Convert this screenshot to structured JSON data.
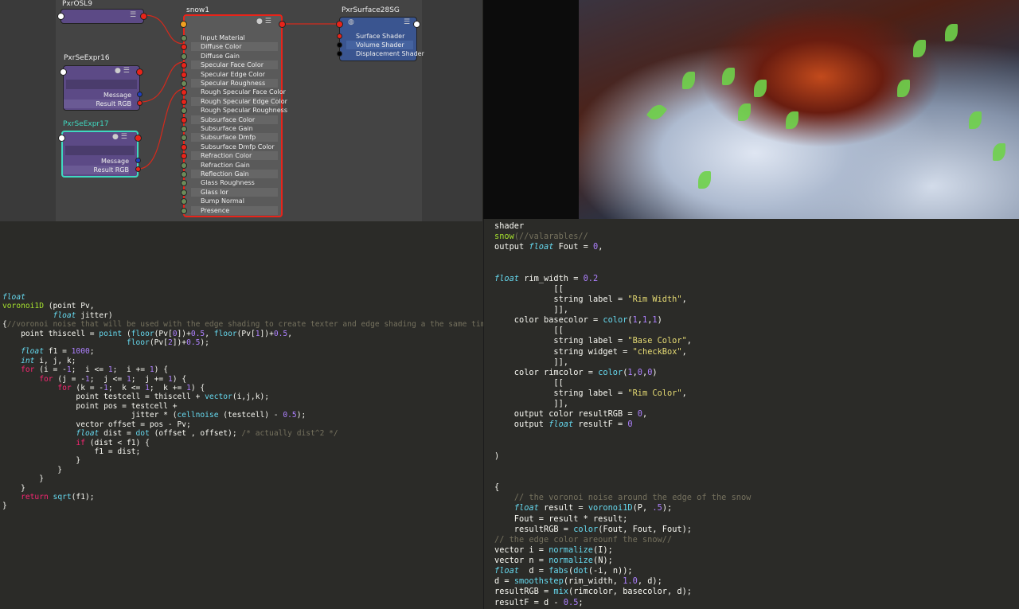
{
  "node_editor": {
    "nodes": {
      "osl": {
        "title": "PxrOSL9"
      },
      "seexpr16": {
        "title": "PxrSeExpr16",
        "ports": [
          "Message",
          "Result RGB"
        ]
      },
      "seexpr17": {
        "title": "PxrSeExpr17",
        "ports": [
          "Message",
          "Result RGB"
        ]
      },
      "snow": {
        "title": "snow1",
        "ports": [
          "Input Material",
          "Diffuse Color",
          "Diffuse Gain",
          "Specular Face Color",
          "Specular Edge Color",
          "Specular Roughness",
          "Rough Specular Face Color",
          "Rough Specular Edge Color",
          "Rough Specular Roughness",
          "Subsurface Color",
          "Subsurface Gain",
          "Subsurface Dmfp",
          "Subsurface Dmfp Color",
          "Refraction Color",
          "Refraction Gain",
          "Reflection Gain",
          "Glass Roughness",
          "Glass Ior",
          "Bump Normal",
          "Presence"
        ],
        "connected": [
          false,
          true,
          false,
          true,
          true,
          false,
          true,
          true,
          false,
          true,
          false,
          false,
          true,
          true,
          false,
          false,
          false,
          false,
          false,
          false
        ]
      },
      "surface": {
        "title": "PxrSurface28SG",
        "ports": [
          "Surface Shader",
          "Volume Shader",
          "Displacement Shader"
        ]
      }
    },
    "colors": {
      "accent_red": "#e8241a",
      "selected_teal": "#3fd9c0",
      "node_purple": "#5c4a86",
      "node_blue": "#3a5590"
    }
  },
  "code_left": [
    [
      [
        "type",
        "float"
      ]
    ],
    [
      [
        "def",
        "voronoi1D"
      ],
      [
        "plain",
        " (point Pv,"
      ]
    ],
    [
      [
        "plain",
        "           "
      ],
      [
        "type",
        "float"
      ],
      [
        "plain",
        " jitter)"
      ]
    ],
    [
      [
        "plain",
        "{"
      ],
      [
        "cm",
        "//voronoi noise that will be used with the edge shading to create texter and edge shading a the same time//"
      ]
    ],
    [
      [
        "plain",
        "    point thiscell = "
      ],
      [
        "fn",
        "point"
      ],
      [
        "plain",
        " ("
      ],
      [
        "fn",
        "floor"
      ],
      [
        "plain",
        "(Pv["
      ],
      [
        "num",
        "0"
      ],
      [
        "plain",
        "])+"
      ],
      [
        "num",
        "0.5"
      ],
      [
        "plain",
        ", "
      ],
      [
        "fn",
        "floor"
      ],
      [
        "plain",
        "(Pv["
      ],
      [
        "num",
        "1"
      ],
      [
        "plain",
        "])+"
      ],
      [
        "num",
        "0.5"
      ],
      [
        "plain",
        ","
      ]
    ],
    [
      [
        "plain",
        "                           "
      ],
      [
        "fn",
        "floor"
      ],
      [
        "plain",
        "(Pv["
      ],
      [
        "num",
        "2"
      ],
      [
        "plain",
        "])+"
      ],
      [
        "num",
        "0.5"
      ],
      [
        "plain",
        ");"
      ]
    ],
    [
      [
        "plain",
        "    "
      ],
      [
        "type",
        "float"
      ],
      [
        "plain",
        " f1 = "
      ],
      [
        "num",
        "1000"
      ],
      [
        "plain",
        ";"
      ]
    ],
    [
      [
        "plain",
        "    "
      ],
      [
        "type",
        "int"
      ],
      [
        "plain",
        " i, j, k;"
      ]
    ],
    [
      [
        "plain",
        "    "
      ],
      [
        "kw",
        "for"
      ],
      [
        "plain",
        " (i = -"
      ],
      [
        "num",
        "1"
      ],
      [
        "plain",
        ";  i <= "
      ],
      [
        "num",
        "1"
      ],
      [
        "plain",
        ";  i += "
      ],
      [
        "num",
        "1"
      ],
      [
        "plain",
        ") {"
      ]
    ],
    [
      [
        "plain",
        "        "
      ],
      [
        "kw",
        "for"
      ],
      [
        "plain",
        " (j = -"
      ],
      [
        "num",
        "1"
      ],
      [
        "plain",
        ";  j <= "
      ],
      [
        "num",
        "1"
      ],
      [
        "plain",
        ";  j += "
      ],
      [
        "num",
        "1"
      ],
      [
        "plain",
        ") {"
      ]
    ],
    [
      [
        "plain",
        "            "
      ],
      [
        "kw",
        "for"
      ],
      [
        "plain",
        " (k = -"
      ],
      [
        "num",
        "1"
      ],
      [
        "plain",
        ";  k <= "
      ],
      [
        "num",
        "1"
      ],
      [
        "plain",
        ";  k += "
      ],
      [
        "num",
        "1"
      ],
      [
        "plain",
        ") {"
      ]
    ],
    [
      [
        "plain",
        "                point testcell = thiscell + "
      ],
      [
        "fn",
        "vector"
      ],
      [
        "plain",
        "(i,j,k);"
      ]
    ],
    [
      [
        "plain",
        "                point pos = testcell +"
      ]
    ],
    [
      [
        "plain",
        "                            jitter * ("
      ],
      [
        "fn",
        "cellnoise"
      ],
      [
        "plain",
        " (testcell) - "
      ],
      [
        "num",
        "0.5"
      ],
      [
        "plain",
        ");"
      ]
    ],
    [
      [
        "plain",
        "                vector offset = pos - Pv;"
      ]
    ],
    [
      [
        "plain",
        "                "
      ],
      [
        "type",
        "float"
      ],
      [
        "plain",
        " dist = "
      ],
      [
        "fn",
        "dot"
      ],
      [
        "plain",
        " (offset , offset); "
      ],
      [
        "cm",
        "/* actually dist^2 */"
      ]
    ],
    [
      [
        "plain",
        "                "
      ],
      [
        "kw",
        "if"
      ],
      [
        "plain",
        " (dist < f1) {"
      ]
    ],
    [
      [
        "plain",
        "                    f1 = dist;"
      ]
    ],
    [
      [
        "plain",
        "                }"
      ]
    ],
    [
      [
        "plain",
        "            }"
      ]
    ],
    [
      [
        "plain",
        "        }"
      ]
    ],
    [
      [
        "plain",
        "    }"
      ]
    ],
    [
      [
        "plain",
        "    "
      ],
      [
        "kw",
        "return"
      ],
      [
        "plain",
        " "
      ],
      [
        "fn",
        "sqrt"
      ],
      [
        "plain",
        "(f1);"
      ]
    ],
    [
      [
        "plain",
        "}"
      ]
    ]
  ],
  "code_right": [
    [
      [
        "plain",
        "shader"
      ]
    ],
    [
      [
        "def",
        "snow"
      ],
      [
        "cm",
        "(//valarables//"
      ]
    ],
    [
      [
        "plain",
        "output "
      ],
      [
        "type",
        "float"
      ],
      [
        "plain",
        " Fout = "
      ],
      [
        "num",
        "0"
      ],
      [
        "plain",
        ","
      ]
    ],
    [
      [
        "plain",
        ""
      ]
    ],
    [
      [
        "plain",
        ""
      ]
    ],
    [
      [
        "type",
        "float"
      ],
      [
        "plain",
        " rim_width = "
      ],
      [
        "num",
        "0.2"
      ]
    ],
    [
      [
        "plain",
        "            [["
      ]
    ],
    [
      [
        "plain",
        "            string label = "
      ],
      [
        "str",
        "\"Rim Width\""
      ],
      [
        "plain",
        ","
      ]
    ],
    [
      [
        "plain",
        "            ]],"
      ]
    ],
    [
      [
        "plain",
        "    color basecolor = "
      ],
      [
        "fn",
        "color"
      ],
      [
        "plain",
        "("
      ],
      [
        "num",
        "1"
      ],
      [
        "plain",
        ","
      ],
      [
        "num",
        "1"
      ],
      [
        "plain",
        ","
      ],
      [
        "num",
        "1"
      ],
      [
        "plain",
        ")"
      ]
    ],
    [
      [
        "plain",
        "            [["
      ]
    ],
    [
      [
        "plain",
        "            string label = "
      ],
      [
        "str",
        "\"Base Color\""
      ],
      [
        "plain",
        ","
      ]
    ],
    [
      [
        "plain",
        "            string widget = "
      ],
      [
        "str",
        "\"checkBox\""
      ],
      [
        "plain",
        ","
      ]
    ],
    [
      [
        "plain",
        "            ]],"
      ]
    ],
    [
      [
        "plain",
        "    color rimcolor = "
      ],
      [
        "fn",
        "color"
      ],
      [
        "plain",
        "("
      ],
      [
        "num",
        "1"
      ],
      [
        "plain",
        ","
      ],
      [
        "num",
        "0"
      ],
      [
        "plain",
        ","
      ],
      [
        "num",
        "0"
      ],
      [
        "plain",
        ")"
      ]
    ],
    [
      [
        "plain",
        "            [["
      ]
    ],
    [
      [
        "plain",
        "            string label = "
      ],
      [
        "str",
        "\"Rim Color\""
      ],
      [
        "plain",
        ","
      ]
    ],
    [
      [
        "plain",
        "            ]],"
      ]
    ],
    [
      [
        "plain",
        "    output color resultRGB = "
      ],
      [
        "num",
        "0"
      ],
      [
        "plain",
        ","
      ]
    ],
    [
      [
        "plain",
        "    output "
      ],
      [
        "type",
        "float"
      ],
      [
        "plain",
        " resultF = "
      ],
      [
        "num",
        "0"
      ]
    ],
    [
      [
        "plain",
        ""
      ]
    ],
    [
      [
        "plain",
        ""
      ]
    ],
    [
      [
        "plain",
        ")"
      ]
    ],
    [
      [
        "plain",
        ""
      ]
    ],
    [
      [
        "plain",
        ""
      ]
    ],
    [
      [
        "plain",
        "{"
      ]
    ],
    [
      [
        "plain",
        "    "
      ],
      [
        "cm",
        "// the voronoi noise around the edge of the snow"
      ]
    ],
    [
      [
        "plain",
        "    "
      ],
      [
        "type",
        "float"
      ],
      [
        "plain",
        " result = "
      ],
      [
        "fn",
        "voronoi1D"
      ],
      [
        "plain",
        "(P, "
      ],
      [
        "num",
        ".5"
      ],
      [
        "plain",
        ");"
      ]
    ],
    [
      [
        "plain",
        "    Fout = result * result;"
      ]
    ],
    [
      [
        "plain",
        "    resultRGB = "
      ],
      [
        "fn",
        "color"
      ],
      [
        "plain",
        "(Fout, Fout, Fout);"
      ]
    ],
    [
      [
        "cm",
        "// the edge color areounf the snow//"
      ]
    ],
    [
      [
        "plain",
        "vector i = "
      ],
      [
        "fn",
        "normalize"
      ],
      [
        "plain",
        "(I);"
      ]
    ],
    [
      [
        "plain",
        "vector n = "
      ],
      [
        "fn",
        "normalize"
      ],
      [
        "plain",
        "(N);"
      ]
    ],
    [
      [
        "type",
        "float"
      ],
      [
        "plain",
        "  d = "
      ],
      [
        "fn",
        "fabs"
      ],
      [
        "plain",
        "("
      ],
      [
        "fn",
        "dot"
      ],
      [
        "plain",
        "(-i, n));"
      ]
    ],
    [
      [
        "plain",
        "d = "
      ],
      [
        "fn",
        "smoothstep"
      ],
      [
        "plain",
        "(rim_width, "
      ],
      [
        "num",
        "1.0"
      ],
      [
        "plain",
        ", d);"
      ]
    ],
    [
      [
        "plain",
        "resultRGB = "
      ],
      [
        "fn",
        "mix"
      ],
      [
        "plain",
        "(rimcolor, basecolor, d);"
      ]
    ],
    [
      [
        "plain",
        "resultF = d - "
      ],
      [
        "num",
        "0.5"
      ],
      [
        "plain",
        ";"
      ]
    ]
  ]
}
